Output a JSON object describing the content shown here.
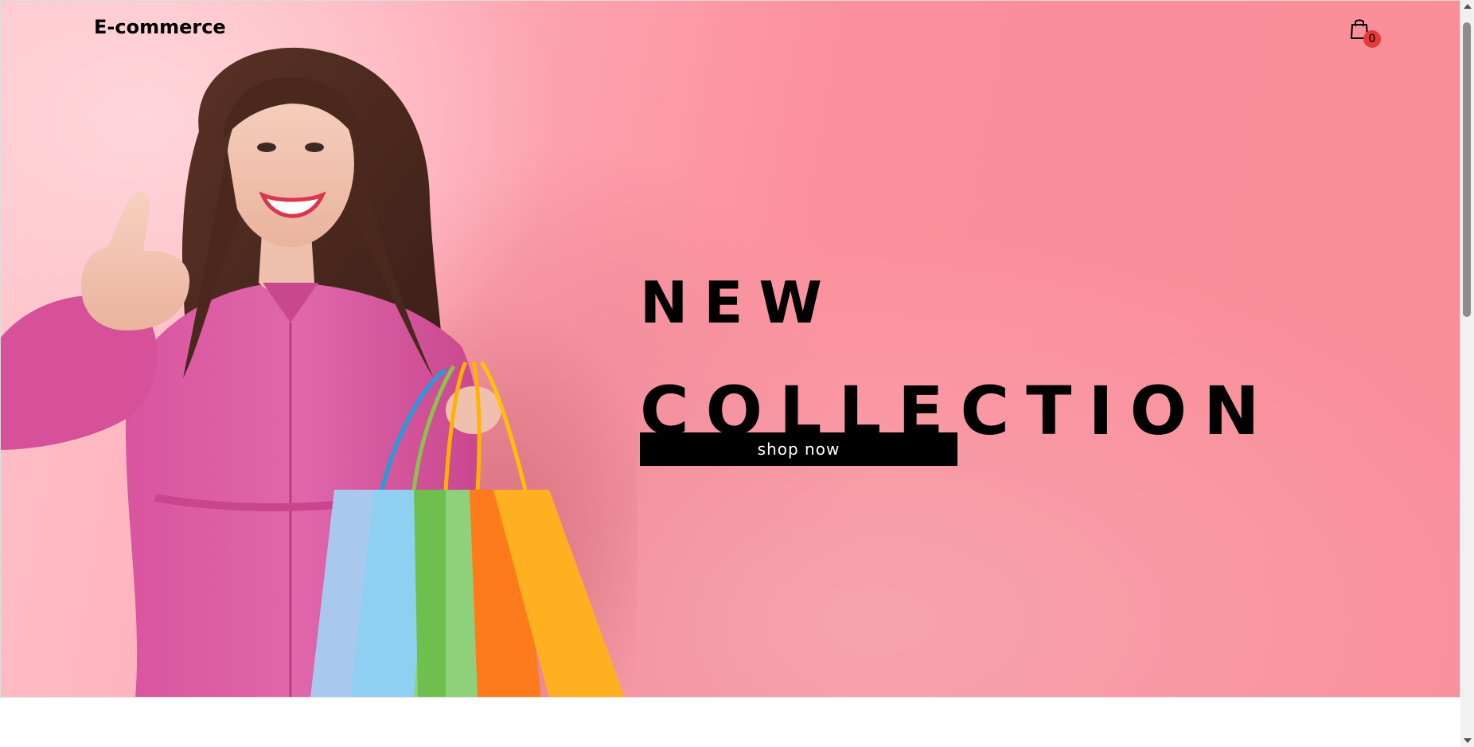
{
  "navbar": {
    "brand": "E-commerce",
    "cart_count": "0",
    "cart_icon": "shopping-bag-icon"
  },
  "hero": {
    "headline_line1": "NEW",
    "headline_line2": "COLLECTION",
    "cta_label": "shop now",
    "image": "woman-holding-shopping-bags-thumbs-up"
  },
  "colors": {
    "hero_background": "#fb8f9b",
    "badge": "#e5393b",
    "button": "#000000",
    "button_text": "#ffffff"
  }
}
